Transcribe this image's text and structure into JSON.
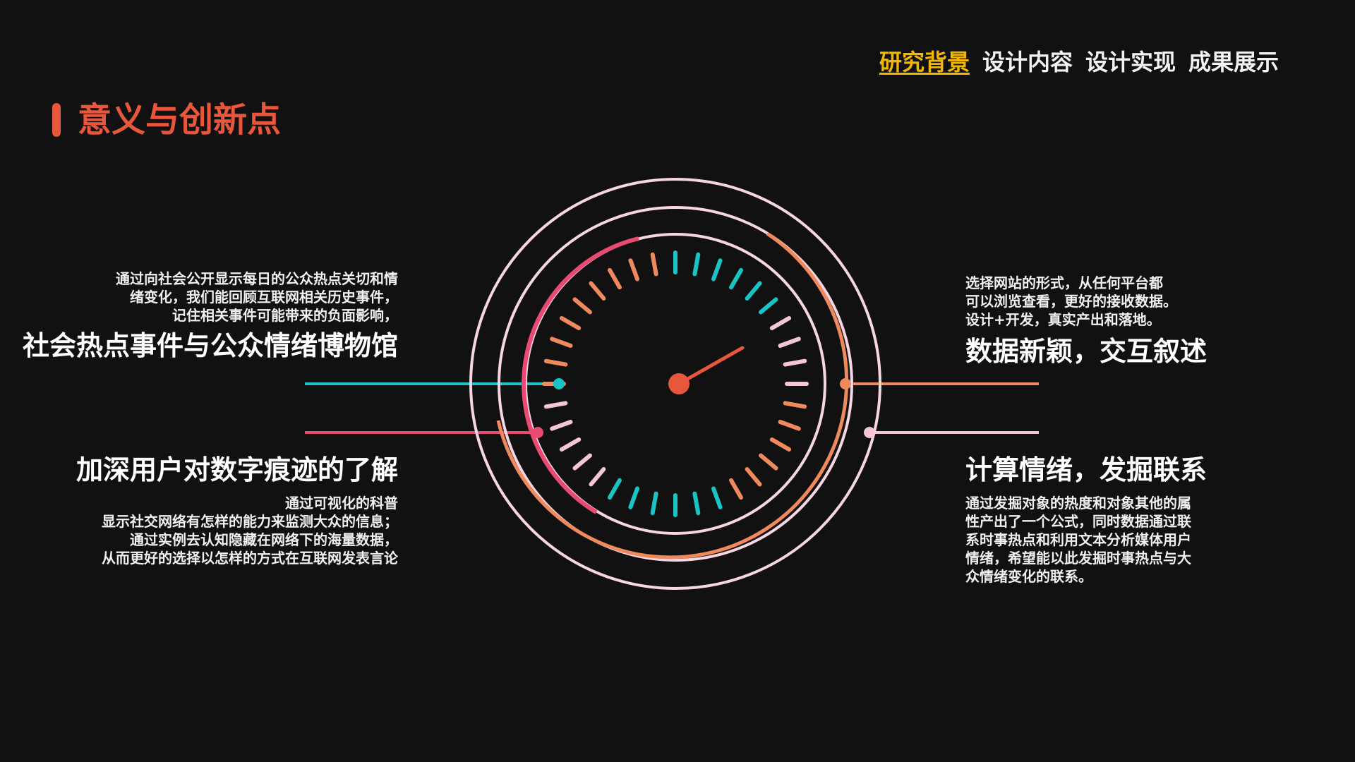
{
  "nav": {
    "items": [
      {
        "label": "研究背景",
        "active": true
      },
      {
        "label": "设计内容",
        "active": false
      },
      {
        "label": "设计实现",
        "active": false
      },
      {
        "label": "成果展示",
        "active": false
      }
    ]
  },
  "section": {
    "title": "意义与创新点"
  },
  "points": {
    "left_top": {
      "desc": [
        "通过向社会公开显示每日的公众热点关切和情",
        "绪变化，我们能回顾互联网相关历史事件，",
        "记住相关事件可能带来的负面影响，"
      ],
      "heading": "社会热点事件与公众情绪博物馆"
    },
    "left_bottom": {
      "heading": "加深用户对数字痕迹的了解",
      "desc": [
        "通过可视化的科普",
        "显示社交网络有怎样的能力来监测大众的信息；",
        "通过实例去认知隐藏在网络下的海量数据，",
        "从而更好的选择以怎样的方式在互联网发表言论"
      ]
    },
    "right_top": {
      "desc": [
        "选择网站的形式，从任何平台都",
        "可以浏览查看，更好的接收数据。",
        "设计+开发，真实产出和落地。"
      ],
      "heading": "数据新颖，交互叙述"
    },
    "right_bottom": {
      "heading": "计算情绪，发掘联系",
      "desc": [
        "通过发掘对象的热度和对象其他的属",
        "性产出了一个公式，同时数据通过联",
        "系时事热点和利用文本分析媒体用户",
        "情绪，希望能以此发掘时事热点与大",
        "众情绪变化的联系。"
      ]
    }
  },
  "colors": {
    "background": "#111111",
    "accent_red": "#e8573c",
    "nav_active": "#f2b705",
    "teal": "#19c4c4",
    "pink": "#e84a72",
    "orange": "#f08a5d",
    "light_pink": "#f5c6d6"
  },
  "icons": {
    "gauge": "gauge-dial-icon"
  }
}
